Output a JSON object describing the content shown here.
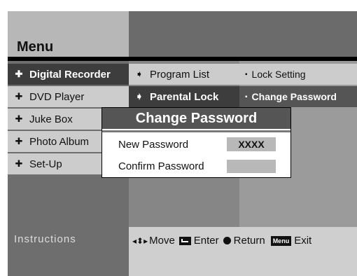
{
  "header": {
    "title": "Menu"
  },
  "main_menu": [
    {
      "label": "Digital Recorder",
      "selected": true
    },
    {
      "label": "DVD Player"
    },
    {
      "label": "Juke Box"
    },
    {
      "label": "Photo Album"
    },
    {
      "label": "Set-Up"
    }
  ],
  "submenu": [
    {
      "label": "Program List"
    },
    {
      "label": "Parental Lock",
      "selected": true
    }
  ],
  "options": [
    {
      "label": "Lock Setting"
    },
    {
      "label": "Change Password",
      "selected": true
    }
  ],
  "dialog": {
    "title": "Change Password",
    "new_password_label": "New Password",
    "new_password_value": "XXXX",
    "confirm_password_label": "Confirm Password",
    "confirm_password_value": ""
  },
  "instructions": {
    "title": "Instructions",
    "move": "Move",
    "enter": "Enter",
    "return": "Return",
    "menu_key": "Menu",
    "exit": "Exit"
  },
  "colors": {
    "selected_bg": "#3d3d3d",
    "item_bg": "#cccccc",
    "panel_bg": "#6e6e6e"
  }
}
